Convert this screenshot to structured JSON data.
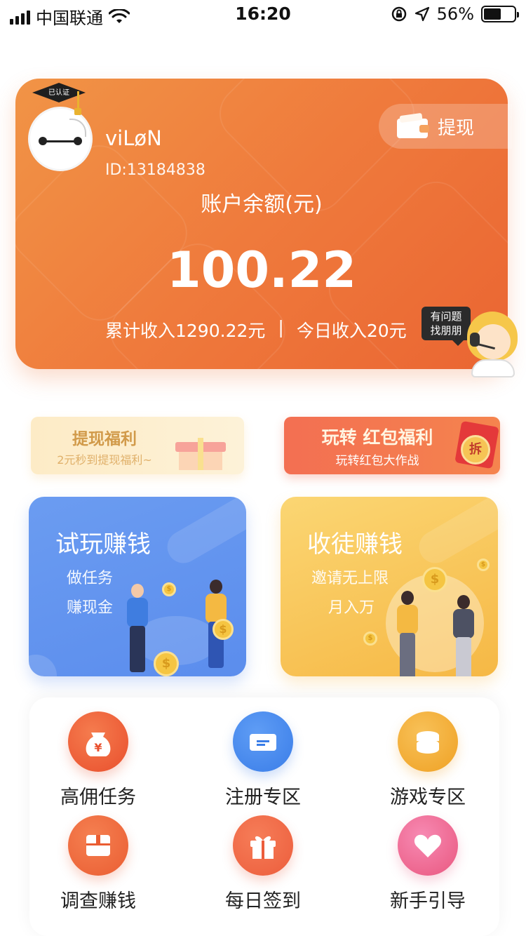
{
  "status_bar": {
    "carrier": "中国联通",
    "time": "16:20",
    "battery_percent": "56%",
    "battery_level": 0.56
  },
  "account": {
    "verified_badge": "已认证",
    "username": "viLøN",
    "user_id": "ID:13184838",
    "withdraw_label": "提现",
    "balance_label": "账户余额(元)",
    "balance": "100.22",
    "total_income": "累计收入1290.22元",
    "separator": "|",
    "today_income": "今日收入20元",
    "help_line1": "有问题",
    "help_line2": "找朋朋"
  },
  "banners": [
    {
      "title": "提现福利",
      "subtitle": "2元秒到提现福利~"
    },
    {
      "title": "玩转 红包福利",
      "subtitle": "玩转红包大作战",
      "badge": "拆"
    }
  ],
  "features": [
    {
      "title": "试玩赚钱",
      "line1": "做任务",
      "line2": "赚现金",
      "color": "#5b8ded"
    },
    {
      "title": "收徒赚钱",
      "line1": "邀请无上限",
      "line2": "月入万",
      "color": "#f6b845"
    }
  ],
  "grid": [
    {
      "label": "高佣任务",
      "icon": "money-bag-icon"
    },
    {
      "label": "注册专区",
      "icon": "ticket-icon"
    },
    {
      "label": "游戏专区",
      "icon": "coin-stack-icon"
    },
    {
      "label": "调查赚钱",
      "icon": "box-icon"
    },
    {
      "label": "每日签到",
      "icon": "gift-icon"
    },
    {
      "label": "新手引导",
      "icon": "heart-icon"
    }
  ],
  "colors": {
    "card_start": "#f19446",
    "card_end": "#ea6532",
    "feature_blue": "#5b8ded",
    "feature_gold": "#f6b845"
  }
}
